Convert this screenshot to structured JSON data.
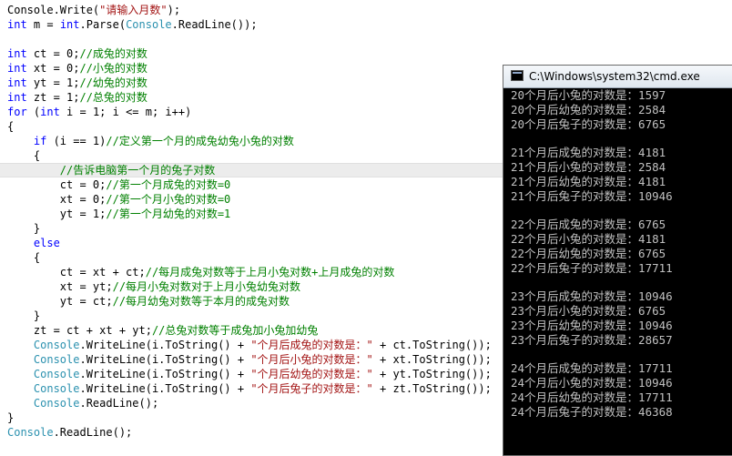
{
  "editor": {
    "lines": [
      [
        {
          "t": "plain",
          "s": "Console"
        },
        {
          "t": "plain",
          "s": ".Write("
        },
        {
          "t": "str",
          "s": "\"请输入月数\""
        },
        {
          "t": "plain",
          "s": ");"
        }
      ],
      [
        {
          "t": "kw",
          "s": "int"
        },
        {
          "t": "plain",
          "s": " m = "
        },
        {
          "t": "kw",
          "s": "int"
        },
        {
          "t": "plain",
          "s": ".Parse("
        },
        {
          "t": "type",
          "s": "Console"
        },
        {
          "t": "plain",
          "s": ".ReadLine());"
        }
      ],
      [],
      [
        {
          "t": "kw",
          "s": "int"
        },
        {
          "t": "plain",
          "s": " ct = 0;"
        },
        {
          "t": "comment",
          "s": "//成兔的对数"
        }
      ],
      [
        {
          "t": "kw",
          "s": "int"
        },
        {
          "t": "plain",
          "s": " xt = 0;"
        },
        {
          "t": "comment",
          "s": "//小兔的对数"
        }
      ],
      [
        {
          "t": "kw",
          "s": "int"
        },
        {
          "t": "plain",
          "s": " yt = 1;"
        },
        {
          "t": "comment",
          "s": "//幼兔的对数"
        }
      ],
      [
        {
          "t": "kw",
          "s": "int"
        },
        {
          "t": "plain",
          "s": " zt = 1;"
        },
        {
          "t": "comment",
          "s": "//总兔的对数"
        }
      ],
      [
        {
          "t": "kw",
          "s": "for"
        },
        {
          "t": "plain",
          "s": " ("
        },
        {
          "t": "kw",
          "s": "int"
        },
        {
          "t": "plain",
          "s": " i = 1; i <= m; i++)"
        }
      ],
      [
        {
          "t": "plain",
          "s": "{"
        }
      ],
      [
        {
          "t": "plain",
          "s": "    "
        },
        {
          "t": "kw",
          "s": "if"
        },
        {
          "t": "plain",
          "s": " (i == 1)"
        },
        {
          "t": "comment",
          "s": "//定义第一个月的成兔幼兔小兔的对数"
        }
      ],
      [
        {
          "t": "plain",
          "s": "    {"
        }
      ],
      [
        {
          "t": "plain",
          "s": "        "
        },
        {
          "t": "comment",
          "s": "//告诉电脑第一个月的兔子对数"
        }
      ],
      [
        {
          "t": "plain",
          "s": "        ct = 0;"
        },
        {
          "t": "comment",
          "s": "//第一个月成兔的对数=0"
        }
      ],
      [
        {
          "t": "plain",
          "s": "        xt = 0;"
        },
        {
          "t": "comment",
          "s": "//第一个月小兔的对数=0"
        }
      ],
      [
        {
          "t": "plain",
          "s": "        yt = 1;"
        },
        {
          "t": "comment",
          "s": "//第一个月幼兔的对数=1"
        }
      ],
      [
        {
          "t": "plain",
          "s": "    }"
        }
      ],
      [
        {
          "t": "plain",
          "s": "    "
        },
        {
          "t": "kw",
          "s": "else"
        }
      ],
      [
        {
          "t": "plain",
          "s": "    {"
        }
      ],
      [
        {
          "t": "plain",
          "s": "        ct = xt + ct;"
        },
        {
          "t": "comment",
          "s": "//每月成兔对数等于上月小兔对数+上月成兔的对数"
        }
      ],
      [
        {
          "t": "plain",
          "s": "        xt = yt;"
        },
        {
          "t": "comment",
          "s": "//每月小兔对数对于上月小兔幼兔对数"
        }
      ],
      [
        {
          "t": "plain",
          "s": "        yt = ct;"
        },
        {
          "t": "comment",
          "s": "//每月幼兔对数等于本月的成兔对数"
        }
      ],
      [
        {
          "t": "plain",
          "s": "    }"
        }
      ],
      [
        {
          "t": "plain",
          "s": "    zt = ct + xt + yt;"
        },
        {
          "t": "comment",
          "s": "//总兔对数等于成兔加小兔加幼兔"
        }
      ],
      [
        {
          "t": "plain",
          "s": "    "
        },
        {
          "t": "type",
          "s": "Console"
        },
        {
          "t": "plain",
          "s": ".WriteLine(i.ToString() + "
        },
        {
          "t": "str",
          "s": "\"个月后成兔的对数是：\""
        },
        {
          "t": "plain",
          "s": " + ct.ToString());"
        }
      ],
      [
        {
          "t": "plain",
          "s": "    "
        },
        {
          "t": "type",
          "s": "Console"
        },
        {
          "t": "plain",
          "s": ".WriteLine(i.ToString() + "
        },
        {
          "t": "str",
          "s": "\"个月后小兔的对数是：\""
        },
        {
          "t": "plain",
          "s": " + xt.ToString());"
        }
      ],
      [
        {
          "t": "plain",
          "s": "    "
        },
        {
          "t": "type",
          "s": "Console"
        },
        {
          "t": "plain",
          "s": ".WriteLine(i.ToString() + "
        },
        {
          "t": "str",
          "s": "\"个月后幼兔的对数是：\""
        },
        {
          "t": "plain",
          "s": " + yt.ToString());"
        }
      ],
      [
        {
          "t": "plain",
          "s": "    "
        },
        {
          "t": "type",
          "s": "Console"
        },
        {
          "t": "plain",
          "s": ".WriteLine(i.ToString() + "
        },
        {
          "t": "str",
          "s": "\"个月后兔子的对数是：\""
        },
        {
          "t": "plain",
          "s": " + zt.ToString());"
        }
      ],
      [
        {
          "t": "plain",
          "s": "    "
        },
        {
          "t": "type",
          "s": "Console"
        },
        {
          "t": "plain",
          "s": ".ReadLine();"
        }
      ],
      [
        {
          "t": "plain",
          "s": "}"
        }
      ],
      [
        {
          "t": "type",
          "s": "Console"
        },
        {
          "t": "plain",
          "s": ".ReadLine();"
        }
      ]
    ],
    "highlight_line": 11
  },
  "cmd": {
    "title": "C:\\Windows\\system32\\cmd.exe",
    "output": [
      "20个月后小兔的对数是：1597",
      "20个月后幼兔的对数是：2584",
      "20个月后兔子的对数是：6765",
      "",
      "21个月后成兔的对数是：4181",
      "21个月后小兔的对数是：2584",
      "21个月后幼兔的对数是：4181",
      "21个月后兔子的对数是：10946",
      "",
      "22个月后成兔的对数是：6765",
      "22个月后小兔的对数是：4181",
      "22个月后幼兔的对数是：6765",
      "22个月后兔子的对数是：17711",
      "",
      "23个月后成兔的对数是：10946",
      "23个月后小兔的对数是：6765",
      "23个月后幼兔的对数是：10946",
      "23个月后兔子的对数是：28657",
      "",
      "24个月后成兔的对数是：17711",
      "24个月后小兔的对数是：10946",
      "24个月后幼兔的对数是：17711",
      "24个月后兔子的对数是：46368"
    ]
  },
  "colors": {
    "keyword": "#0000ff",
    "type": "#2b91af",
    "string": "#a31515",
    "comment": "#008000",
    "console_text": "#c0c0c0",
    "console_bg": "#000000"
  }
}
